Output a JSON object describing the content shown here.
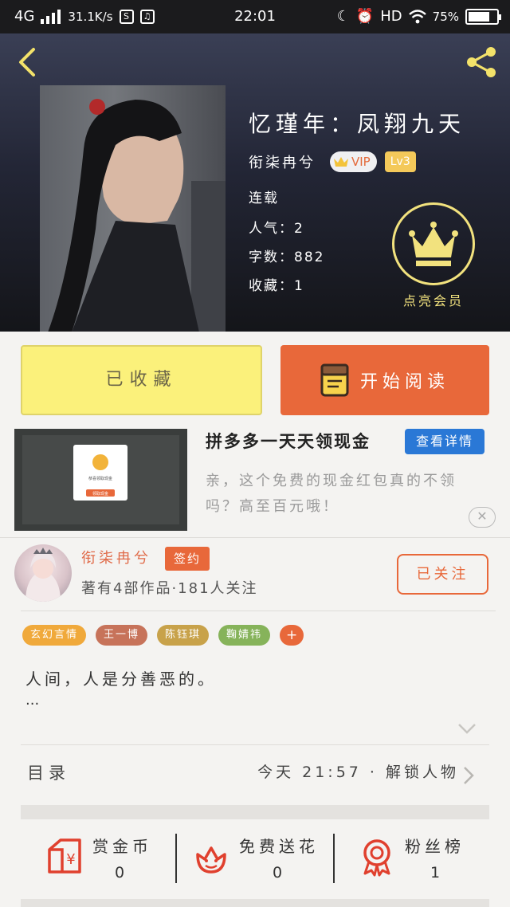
{
  "status_bar": {
    "network": "4G",
    "speed": "31.1K/s",
    "sim_icon": "S",
    "time": "22:01",
    "hd": "HD",
    "battery": "75%",
    "battery_level": 0.75
  },
  "header": {
    "back_icon": "chevron-left-icon",
    "share_icon": "share-icon",
    "book_title": "忆瑾年：凤翔九天",
    "author_name": "衔柒冉兮",
    "vip_label": "VIP",
    "level_label": "Lv3",
    "status": "连载",
    "popularity": "人气：2",
    "word_count": "字数：882",
    "favorites": "收藏：1",
    "member_label": "点亮会员"
  },
  "actions": {
    "favorited_label": "已收藏",
    "read_label": "开始阅读"
  },
  "ad": {
    "title": "拼多多一天天领现金",
    "button": "查看详情",
    "desc": "亲，这个免费的现金红包真的不领吗？高至百元哦！",
    "image_caption": "恭喜领取现金",
    "image_button": "领取现金",
    "close_icon": "close-icon"
  },
  "author": {
    "name": "衔柒冉兮",
    "badge": "签约",
    "stats": "著有4部作品·181人关注",
    "follow_label": "已关注"
  },
  "tags": [
    {
      "label": "玄幻言情",
      "color": "#f0a93b"
    },
    {
      "label": "王一博",
      "color": "#c7735a"
    },
    {
      "label": "陈钰琪",
      "color": "#c8a24a"
    },
    {
      "label": "鞠婧祎",
      "color": "#86b35a"
    }
  ],
  "tag_add": {
    "label": "+",
    "color": "#e8683a"
  },
  "synopsis": {
    "text": "人间，人是分善恶的。",
    "more": "..."
  },
  "toc": {
    "label": "目录",
    "update": "今天 21:57 · 解锁人物"
  },
  "stats": {
    "coins_label": "赏金币",
    "coins_value": "0",
    "flowers_label": "免费送花",
    "flowers_value": "0",
    "fans_label": "粉丝榜",
    "fans_value": "1"
  },
  "colors": {
    "accent": "#e8683a",
    "favorite_yellow": "#fbf17b",
    "crown_yellow": "#f2e27e",
    "ad_blue": "#2a78d6"
  }
}
